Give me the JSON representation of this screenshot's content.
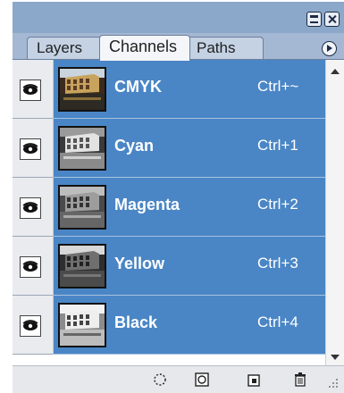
{
  "panel": {
    "tabs": [
      {
        "label": "Layers",
        "active": false
      },
      {
        "label": "Channels",
        "active": true
      },
      {
        "label": "Paths",
        "active": false
      }
    ],
    "window_buttons": [
      "minimize-icon",
      "close-icon"
    ],
    "menu_button_icon": "panel-menu-icon"
  },
  "channels": [
    {
      "name": "CMYK",
      "shortcut": "Ctrl+~",
      "visible": true,
      "selected": true,
      "thumbnail": "color"
    },
    {
      "name": "Cyan",
      "shortcut": "Ctrl+1",
      "visible": true,
      "selected": true,
      "thumbnail": "grayscale"
    },
    {
      "name": "Magenta",
      "shortcut": "Ctrl+2",
      "visible": true,
      "selected": true,
      "thumbnail": "grayscale"
    },
    {
      "name": "Yellow",
      "shortcut": "Ctrl+3",
      "visible": true,
      "selected": true,
      "thumbnail": "grayscale"
    },
    {
      "name": "Black",
      "shortcut": "Ctrl+4",
      "visible": true,
      "selected": true,
      "thumbnail": "grayscale"
    }
  ],
  "bottom_bar": {
    "icons": [
      "load-selection-icon",
      "save-selection-icon",
      "new-channel-icon",
      "trash-icon"
    ]
  },
  "colors": {
    "selection": "#4a86c5",
    "panel_header": "#8ba7ca",
    "list_background": "#f0f0f0"
  }
}
